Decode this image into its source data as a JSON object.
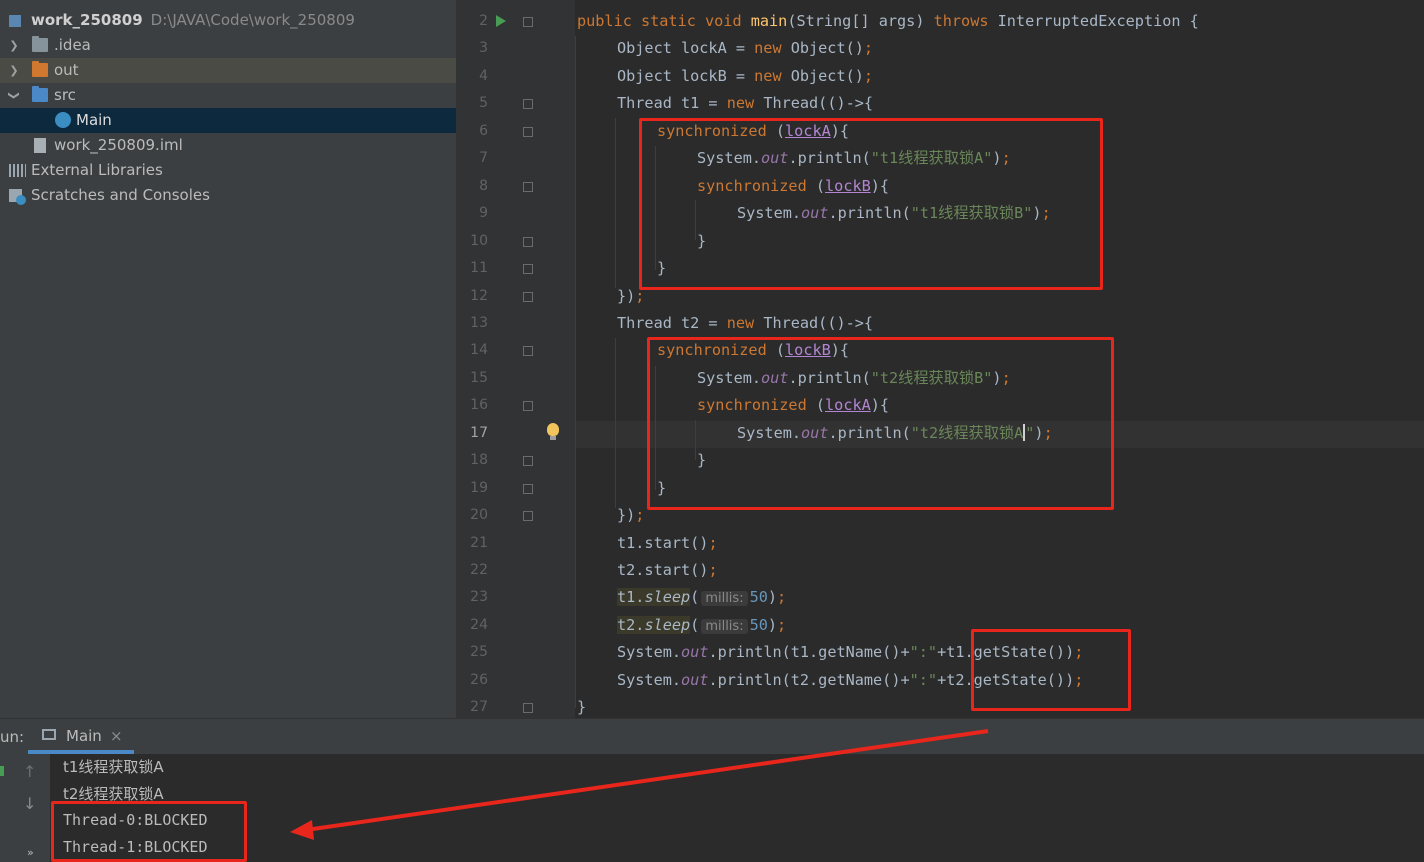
{
  "project": {
    "name": "work_250809",
    "path": "D:\\JAVA\\Code\\work_250809",
    "items": [
      {
        "label": ".idea"
      },
      {
        "label": "out"
      },
      {
        "label": "src"
      },
      {
        "label": "Main"
      },
      {
        "label": "work_250809.iml"
      },
      {
        "label": "External Libraries"
      },
      {
        "label": "Scratches and Consoles"
      }
    ]
  },
  "editor": {
    "current_line": "17",
    "lines": [
      {
        "n": "2",
        "p": [
          "public static void ",
          "main",
          "(String[] args) ",
          "throws",
          " InterruptedException {"
        ]
      },
      {
        "n": "3",
        "p": [
          "Object lockA = ",
          "new",
          " Object()",
          ";"
        ]
      },
      {
        "n": "4",
        "p": [
          "Object lockB = ",
          "new",
          " Object()",
          ";"
        ]
      },
      {
        "n": "5",
        "p": [
          "Thread t1 = ",
          "new",
          " Thread(()->{"
        ]
      },
      {
        "n": "6",
        "p": [
          "synchronized",
          " (",
          "lockA",
          "){"
        ]
      },
      {
        "n": "7",
        "p": [
          "System.",
          "out",
          ".println(",
          "\"t1线程获取锁A\"",
          ")",
          ";"
        ]
      },
      {
        "n": "8",
        "p": [
          "synchronized",
          " (",
          "lockB",
          "){"
        ]
      },
      {
        "n": "9",
        "p": [
          "System.",
          "out",
          ".println(",
          "\"t1线程获取锁B\"",
          ")",
          ";"
        ]
      },
      {
        "n": "10",
        "p": [
          "}"
        ]
      },
      {
        "n": "11",
        "p": [
          "}"
        ]
      },
      {
        "n": "12",
        "p": [
          "})",
          ";"
        ]
      },
      {
        "n": "13",
        "p": [
          "Thread t2 = ",
          "new",
          " Thread(()->{"
        ]
      },
      {
        "n": "14",
        "p": [
          "synchronized",
          " (",
          "lockB",
          "){"
        ]
      },
      {
        "n": "15",
        "p": [
          "System.",
          "out",
          ".println(",
          "\"t2线程获取锁B\"",
          ")",
          ";"
        ]
      },
      {
        "n": "16",
        "p": [
          "synchronized",
          " (",
          "lockA",
          "){"
        ]
      },
      {
        "n": "17",
        "p": [
          "System.",
          "out",
          ".println(",
          "\"t2线程获取锁A",
          "\"",
          ")",
          ";"
        ]
      },
      {
        "n": "18",
        "p": [
          "}"
        ]
      },
      {
        "n": "19",
        "p": [
          "}"
        ]
      },
      {
        "n": "20",
        "p": [
          "})",
          ";"
        ]
      },
      {
        "n": "21",
        "p": [
          "t1.start()",
          ";"
        ]
      },
      {
        "n": "22",
        "p": [
          "t2.start()",
          ";"
        ]
      },
      {
        "n": "23",
        "p": [
          "t1.",
          "sleep",
          "(",
          "millis:",
          "50",
          ")",
          ";"
        ]
      },
      {
        "n": "24",
        "p": [
          "t2.",
          "sleep",
          "(",
          "millis:",
          "50",
          ")",
          ";"
        ]
      },
      {
        "n": "25",
        "p": [
          "System.",
          "out",
          ".println(t1.getName()+",
          "\":\"",
          "+t1.getState())",
          ";"
        ]
      },
      {
        "n": "26",
        "p": [
          "System.",
          "out",
          ".println(t2.getName()+",
          "\":\"",
          "+t2.getState())",
          ";"
        ]
      },
      {
        "n": "27",
        "p": [
          "}"
        ]
      }
    ]
  },
  "run": {
    "label": "un:",
    "tab": "Main",
    "close": "×",
    "more": "»",
    "output": [
      "t1线程获取锁A",
      "t2线程获取锁A",
      "Thread-0:BLOCKED",
      "Thread-1:BLOCKED"
    ]
  },
  "colors": {
    "annotation": "#e8261c",
    "keyword": "#cc7832",
    "string": "#6a8759",
    "field": "#9876aa"
  }
}
